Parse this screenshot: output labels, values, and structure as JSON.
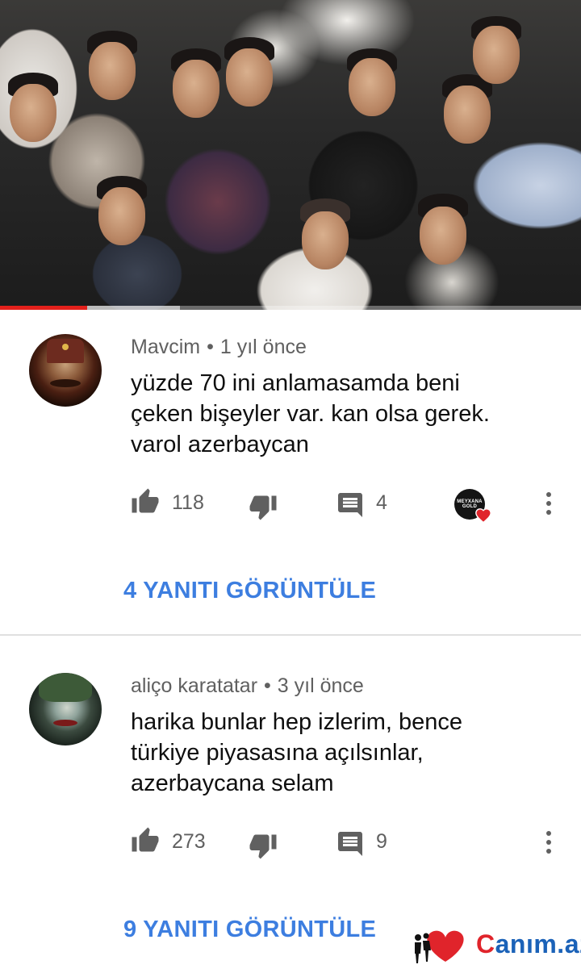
{
  "video": {
    "progress": 0.15,
    "buffered": 0.31,
    "colors": {
      "progress": "#e3201b"
    }
  },
  "comments": [
    {
      "author": "Mavcim",
      "separator": "•",
      "time": "1 yıl önce",
      "text_lines": [
        "yüzde 70 ini anlamasamda beni",
        "çeken bişeyler var. kan olsa gerek.",
        "varol azerbaycan"
      ],
      "likes": "118",
      "replies_count": "4",
      "creator_heart": true,
      "creator_badge": "MEYXANA GOLD",
      "view_replies": "4 YANITI GÖRÜNTÜLE"
    },
    {
      "author": "aliço karatatar",
      "separator": "•",
      "time": "3 yıl önce",
      "text_lines": [
        "harika bunlar hep izlerim, bence",
        "türkiye piyasasına açılsınlar,",
        "azerbaycana selam"
      ],
      "likes": "273",
      "replies_count": "9",
      "creator_heart": false,
      "view_replies": "9 YANITI GÖRÜNTÜLE"
    }
  ],
  "icons": {
    "like": "thumb-up-icon",
    "dislike": "thumb-down-icon",
    "reply": "comment-icon",
    "more": "more-vert-icon",
    "heart": "heart-icon"
  },
  "watermark": {
    "prefix": "C",
    "heart_letter": "a",
    "rest": "nım.az"
  },
  "colors": {
    "link": "#3d7ee0",
    "meta": "#606060",
    "text": "#0f0f0f",
    "heart": "#e0242b"
  }
}
